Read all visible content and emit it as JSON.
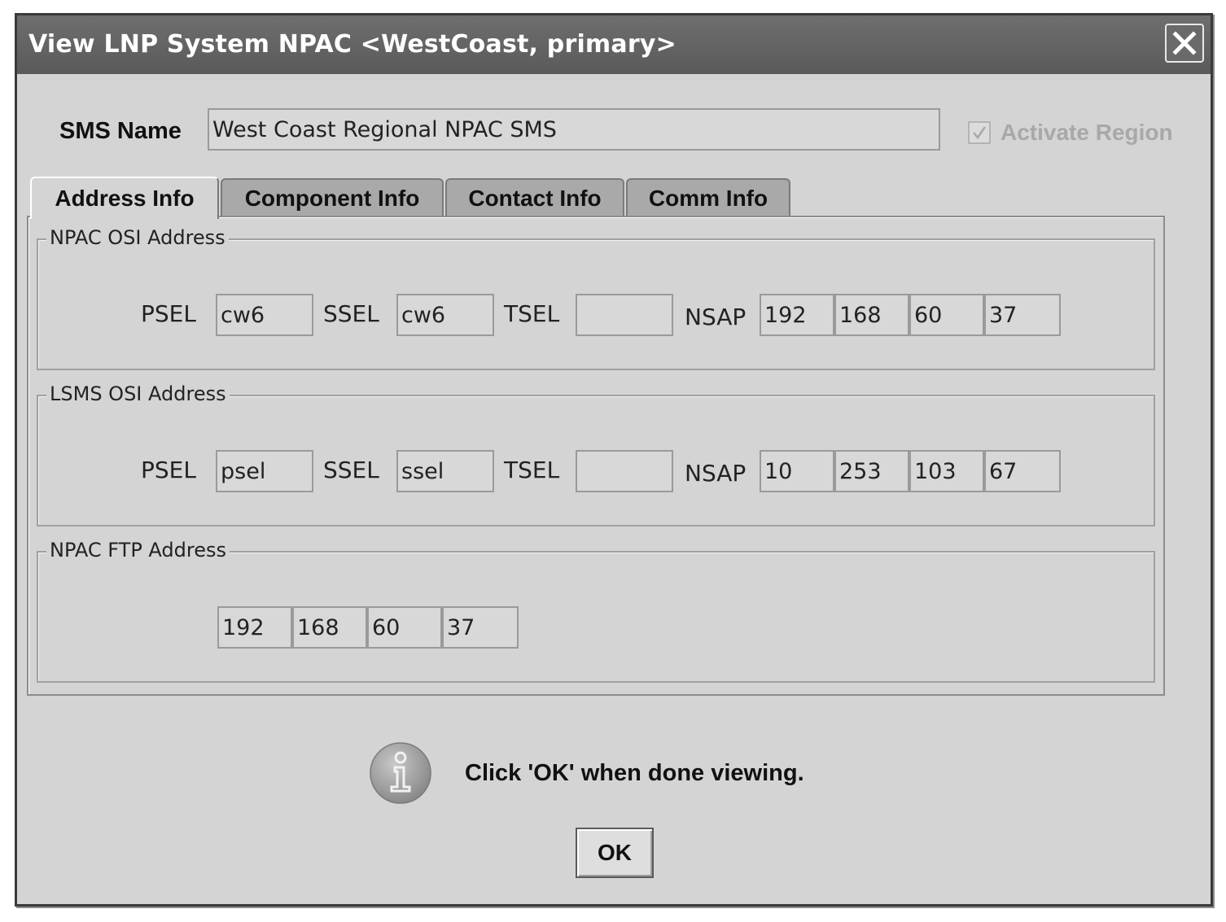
{
  "window": {
    "title": "View LNP System NPAC <WestCoast,  primary>"
  },
  "sms_name": {
    "label": "SMS Name",
    "value": "West Coast Regional NPAC SMS"
  },
  "activate_region": {
    "label": "Activate Region",
    "checked": true,
    "enabled": false
  },
  "tabs": [
    {
      "label": "Address Info",
      "active": true
    },
    {
      "label": "Component Info",
      "active": false
    },
    {
      "label": "Contact Info",
      "active": false
    },
    {
      "label": "Comm Info",
      "active": false
    }
  ],
  "npac_osi": {
    "title": "NPAC OSI Address",
    "psel_label": "PSEL",
    "psel": "cw6",
    "ssel_label": "SSEL",
    "ssel": "cw6",
    "tsel_label": "TSEL",
    "tsel": "",
    "nsap_label": "NSAP",
    "nsap": [
      "192",
      "168",
      "60",
      "37"
    ]
  },
  "lsms_osi": {
    "title": "LSMS OSI Address",
    "psel_label": "PSEL",
    "psel": "psel",
    "ssel_label": "SSEL",
    "ssel": "ssel",
    "tsel_label": "TSEL",
    "tsel": "",
    "nsap_label": "NSAP",
    "nsap": [
      "10",
      "253",
      "103",
      "67"
    ]
  },
  "npac_ftp": {
    "title": "NPAC FTP Address",
    "ip": [
      "192",
      "168",
      "60",
      "37"
    ]
  },
  "message": "Click 'OK' when done viewing.",
  "ok_label": "OK",
  "icons": {
    "close": "close-icon",
    "info": "info-icon",
    "check": "checkmark-icon"
  }
}
